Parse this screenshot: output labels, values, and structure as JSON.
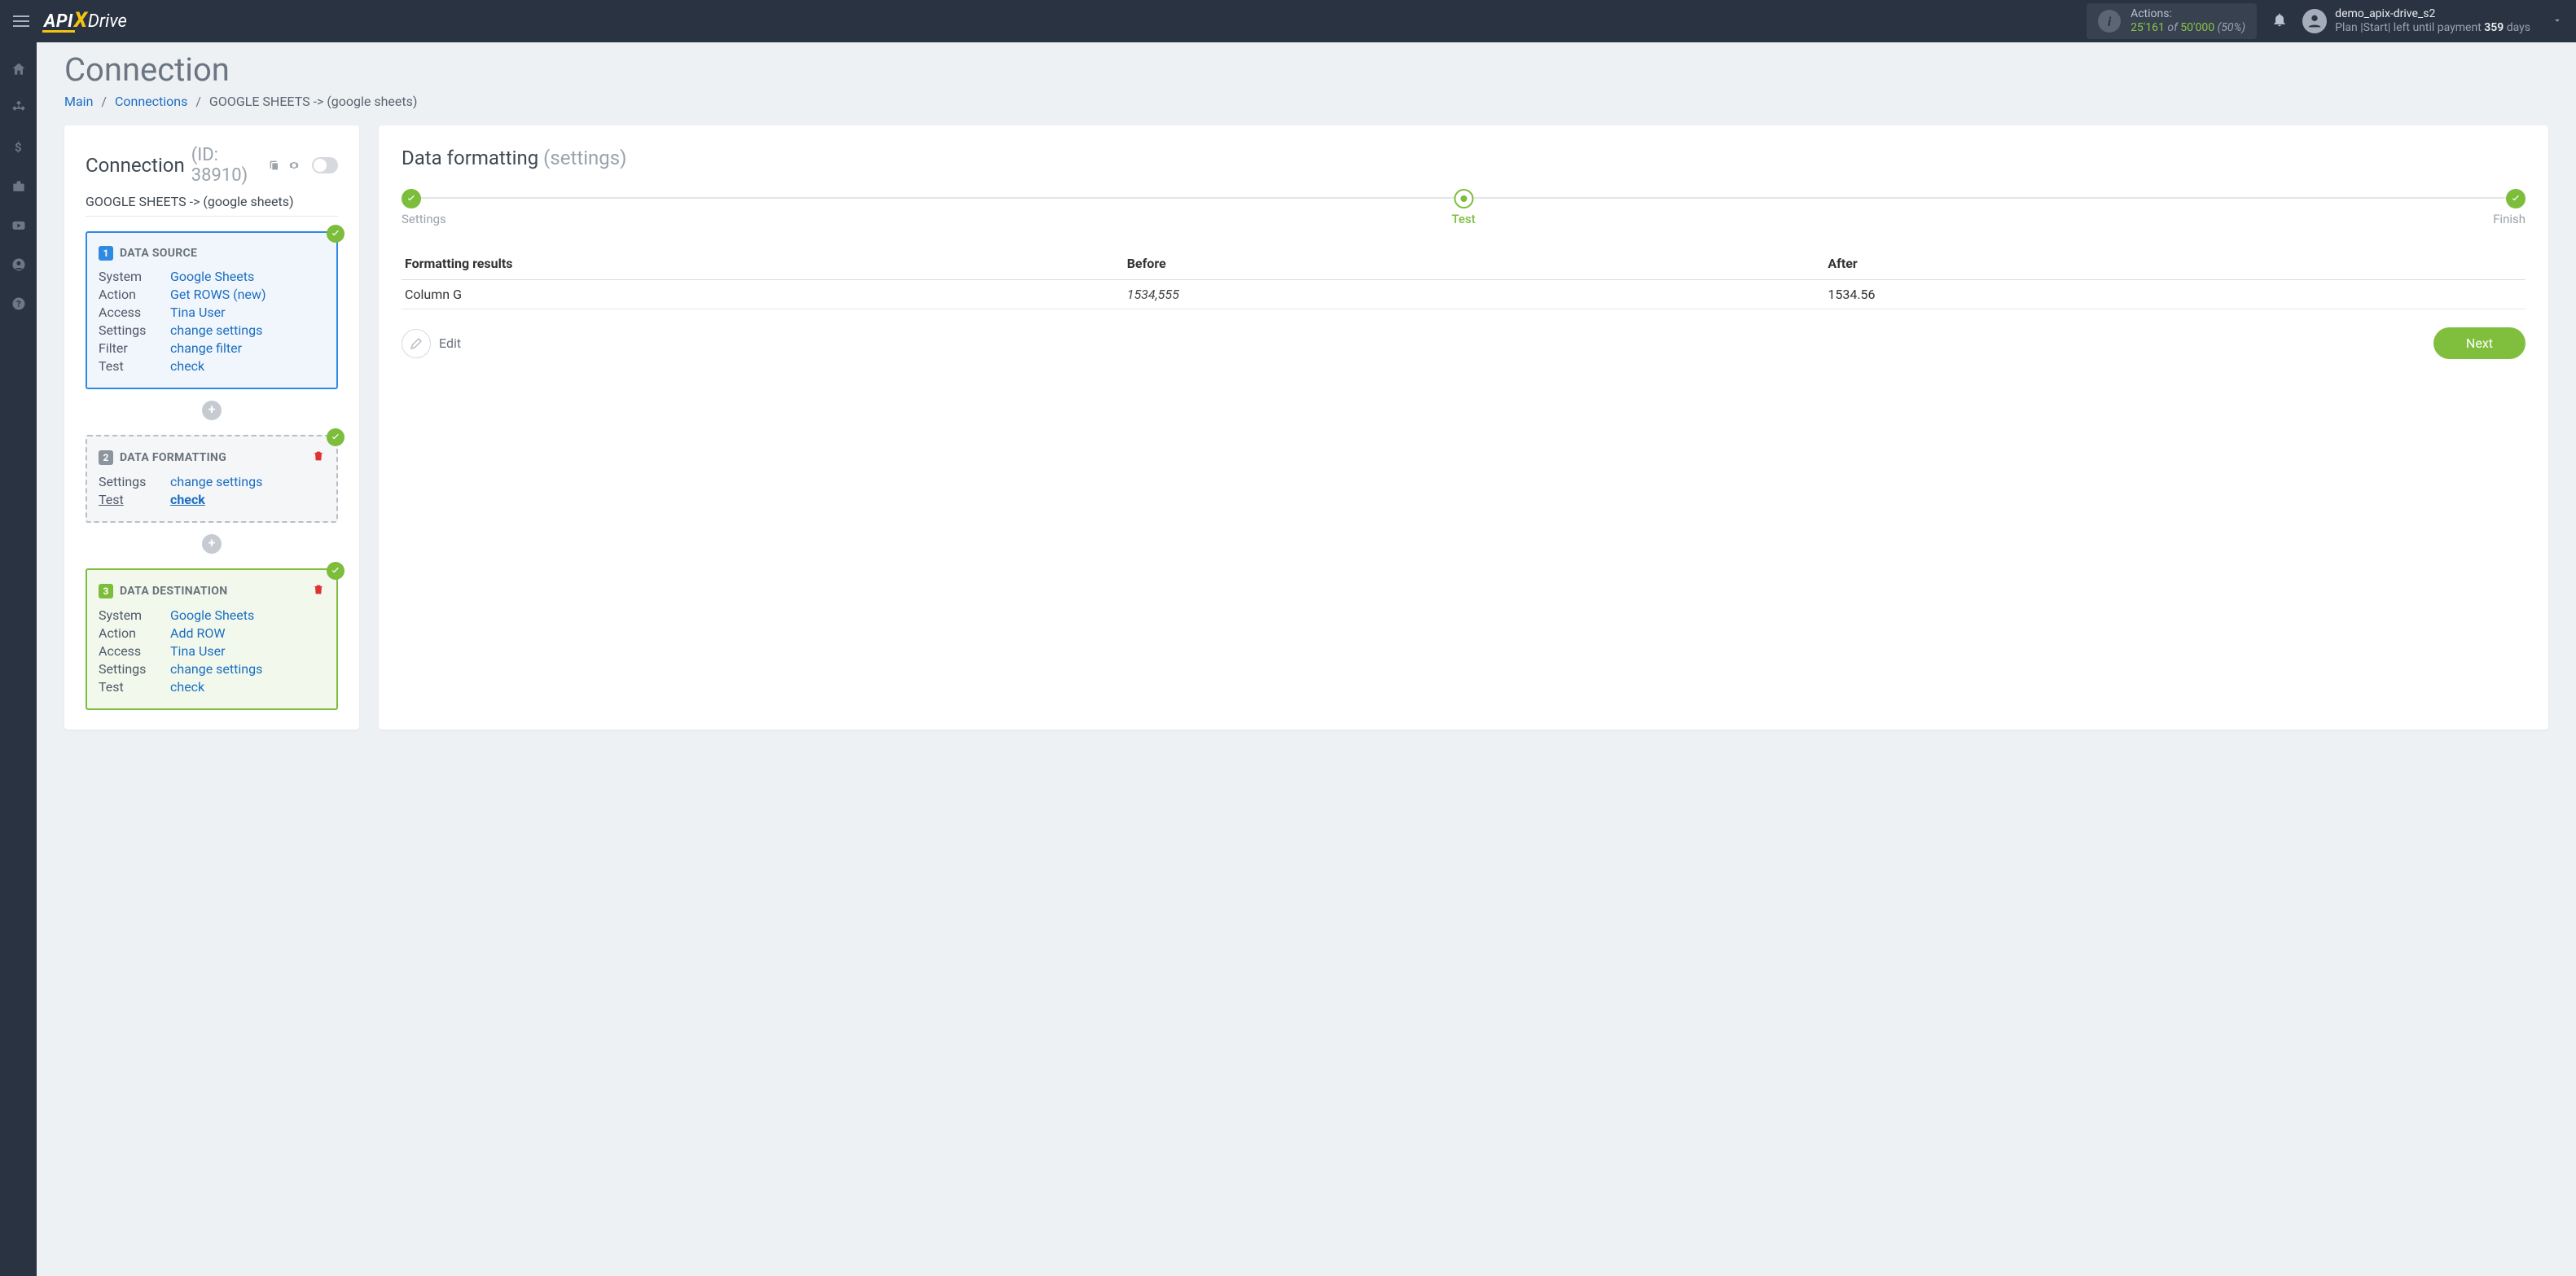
{
  "header": {
    "actions_label": "Actions:",
    "actions_used": "25'161",
    "actions_of": "of",
    "actions_total": "50'000",
    "actions_pct": "(50%)",
    "username": "demo_apix-drive_s2",
    "plan_prefix": "Plan |Start| left until payment ",
    "plan_days": "359",
    "plan_suffix": " days"
  },
  "page": {
    "title": "Connection",
    "breadcrumb": {
      "main": "Main",
      "connections": "Connections",
      "current": "GOOGLE SHEETS -> (google sheets)"
    }
  },
  "left": {
    "conn_head": "Connection",
    "conn_id": "(ID: 38910)",
    "conn_sub": "GOOGLE SHEETS -> (google sheets)",
    "source": {
      "title": "DATA SOURCE",
      "rows": {
        "system_l": "System",
        "system_v": "Google Sheets",
        "action_l": "Action",
        "action_v": "Get ROWS (new)",
        "access_l": "Access",
        "access_v": "Tina User",
        "settings_l": "Settings",
        "settings_v": "change settings",
        "filter_l": "Filter",
        "filter_v": "change filter",
        "test_l": "Test",
        "test_v": "check"
      }
    },
    "formatting": {
      "title": "DATA FORMATTING",
      "rows": {
        "settings_l": "Settings",
        "settings_v": "change settings",
        "test_l": "Test",
        "test_v": "check"
      }
    },
    "destination": {
      "title": "DATA DESTINATION",
      "rows": {
        "system_l": "System",
        "system_v": "Google Sheets",
        "action_l": "Action",
        "action_v": "Add ROW",
        "access_l": "Access",
        "access_v": "Tina User",
        "settings_l": "Settings",
        "settings_v": "change settings",
        "test_l": "Test",
        "test_v": "check"
      }
    }
  },
  "right": {
    "title": "Data formatting",
    "subtitle": "(settings)",
    "steps": {
      "s1": "Settings",
      "s2": "Test",
      "s3": "Finish"
    },
    "table": {
      "h1": "Formatting results",
      "h2": "Before",
      "h3": "After",
      "r1c1": "Column G",
      "r1c2": "1534,555",
      "r1c3": "1534.56"
    },
    "edit": "Edit",
    "next": "Next"
  }
}
